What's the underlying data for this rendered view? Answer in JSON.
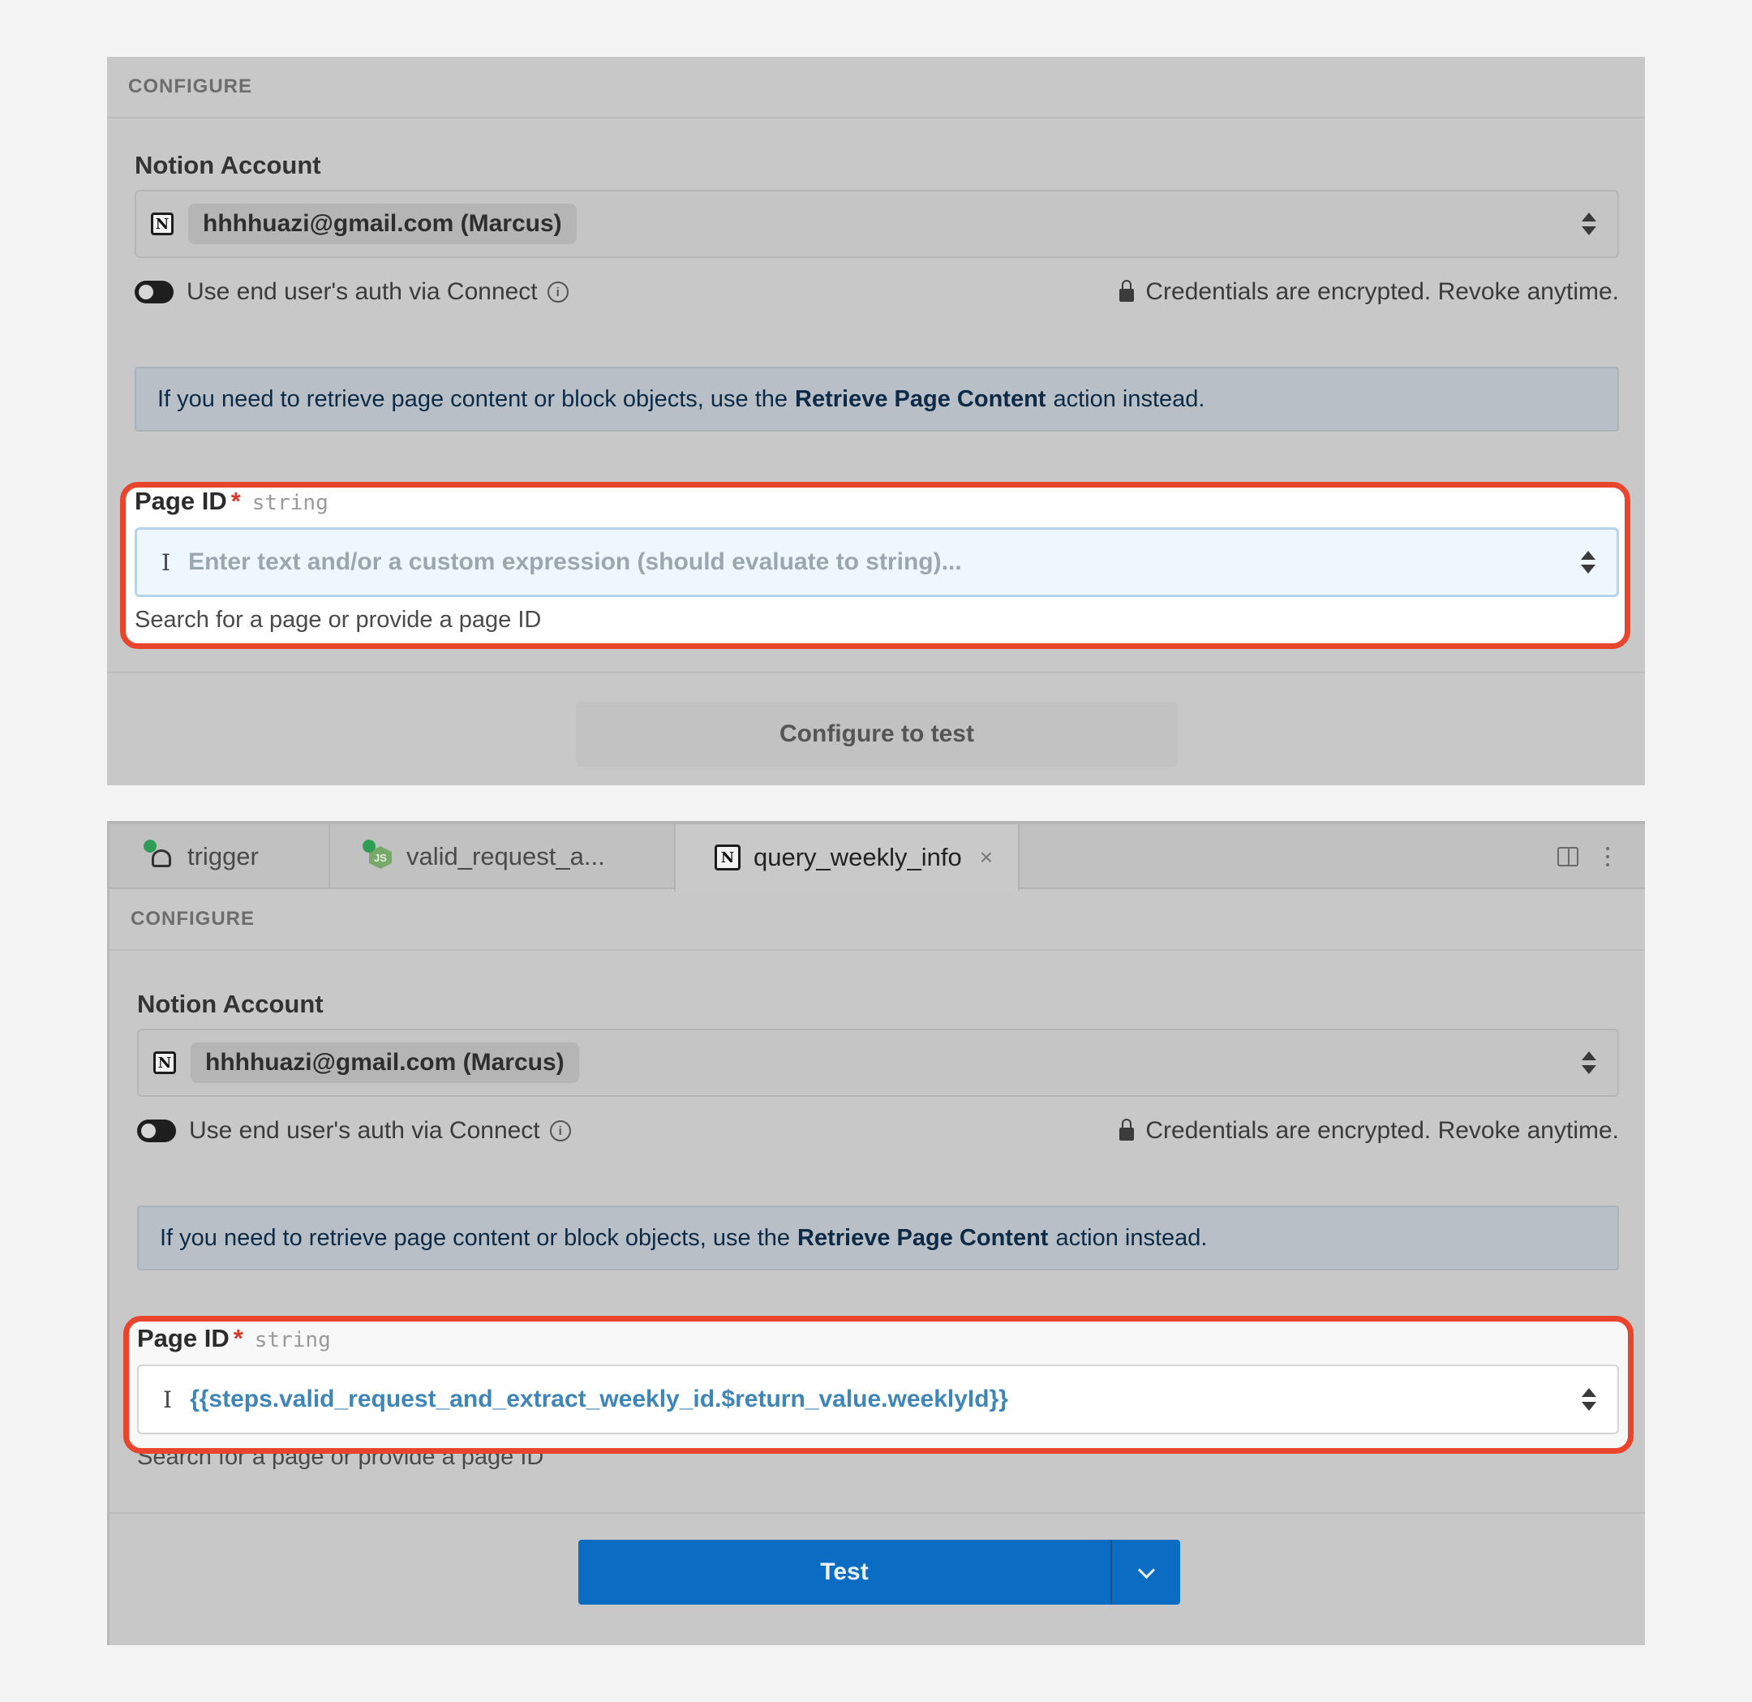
{
  "panel1": {
    "section_header": "CONFIGURE",
    "account_label": "Notion Account",
    "account_value": "hhhhuazi@gmail.com (Marcus)",
    "toggle_label": "Use end user's auth via Connect",
    "credentials_note": "Credentials are encrypted. Revoke anytime.",
    "alert_prefix": "If you need to retrieve page content or block objects, use the",
    "alert_link": "Retrieve Page Content",
    "alert_suffix": "action instead.",
    "page_id_label": "Page ID",
    "required_mark": "*",
    "page_id_type": "string",
    "page_id_placeholder": "Enter text and/or a custom expression (should evaluate to string)...",
    "page_id_help": "Search for a page or provide a page ID",
    "button_label": "Configure to test"
  },
  "panel2": {
    "tabs": [
      {
        "label": "trigger",
        "icon": "webhook-icon",
        "status": "success"
      },
      {
        "label": "valid_request_a...",
        "icon": "nodejs-icon",
        "status": "success"
      },
      {
        "label": "query_weekly_info",
        "icon": "notion-icon",
        "active": true
      }
    ],
    "section_header": "CONFIGURE",
    "account_label": "Notion Account",
    "account_value": "hhhhuazi@gmail.com (Marcus)",
    "toggle_label": "Use end user's auth via Connect",
    "credentials_note": "Credentials are encrypted. Revoke anytime.",
    "alert_prefix": "If you need to retrieve page content or block objects, use the",
    "alert_link": "Retrieve Page Content",
    "alert_suffix": "action instead.",
    "page_id_label": "Page ID",
    "required_mark": "*",
    "page_id_type": "string",
    "page_id_value": "{{steps.valid_request_and_extract_weekly_id.$return_value.weeklyId}}",
    "page_id_help": "Search for a page or provide a page ID",
    "button_label": "Test"
  },
  "colors": {
    "highlight": "#e9442c",
    "primary_button": "#0b6cc4",
    "expression_text": "#3e86b8"
  }
}
